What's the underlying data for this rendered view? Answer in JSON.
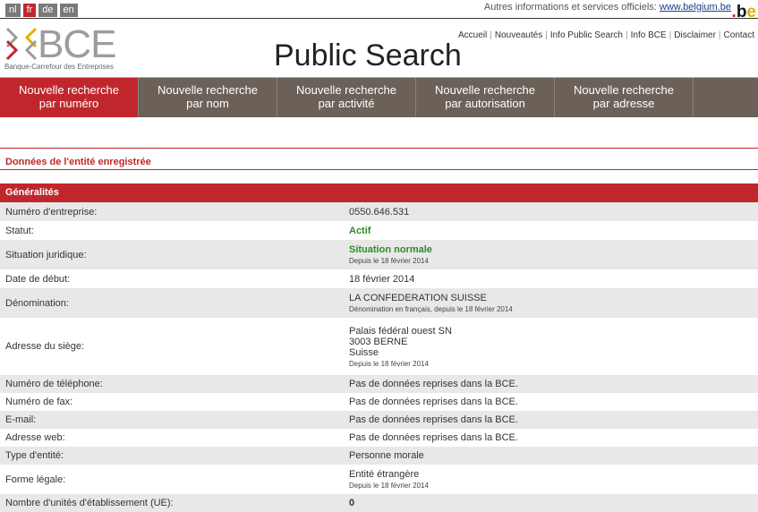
{
  "languages": [
    {
      "code": "nl",
      "active": false
    },
    {
      "code": "fr",
      "active": true
    },
    {
      "code": "de",
      "active": false
    },
    {
      "code": "en",
      "active": false
    }
  ],
  "belgium": {
    "text": "Autres informations et services officiels:",
    "link": "www.belgium.be"
  },
  "be_logo": {
    "b": "b",
    "e": "e",
    "dot": "."
  },
  "logo": {
    "name": "BCE",
    "subtitle": "Banque-Carrefour des Entreprises"
  },
  "page_title": "Public Search",
  "top_links": [
    "Accueil",
    "Nouveautés",
    "Info Public Search",
    "Info BCE",
    "Disclaimer",
    "Contact"
  ],
  "nav": [
    {
      "line1": "Nouvelle recherche",
      "line2": "par numéro",
      "active": true
    },
    {
      "line1": "Nouvelle recherche",
      "line2": "par nom",
      "active": false
    },
    {
      "line1": "Nouvelle recherche",
      "line2": "par activité",
      "active": false
    },
    {
      "line1": "Nouvelle recherche",
      "line2": "par autorisation",
      "active": false
    },
    {
      "line1": "Nouvelle recherche",
      "line2": "par adresse",
      "active": false
    }
  ],
  "section_title": "Données de l'entité enregistrée",
  "table_header": "Généralités",
  "rows": {
    "numero": {
      "label": "Numéro d'entreprise:",
      "value": "0550.646.531"
    },
    "statut": {
      "label": "Statut:",
      "value": "Actif"
    },
    "situation": {
      "label": "Situation juridique:",
      "value": "Situation normale",
      "note": "Depuis le 18 février 2014"
    },
    "date_debut": {
      "label": "Date de début:",
      "value": "18 février 2014"
    },
    "denomination": {
      "label": "Dénomination:",
      "value": "LA CONFEDERATION SUISSE",
      "note": "Dénomination en français, depuis le 18 février 2014"
    },
    "adresse": {
      "label": "Adresse du siège:",
      "line1": "Palais fédéral ouest SN",
      "line2": "3003 BERNE",
      "line3": "Suisse",
      "note": "Depuis le 18 février 2014"
    },
    "telephone": {
      "label": "Numéro de téléphone:",
      "value": "Pas de données reprises dans la BCE."
    },
    "fax": {
      "label": "Numéro de fax:",
      "value": "Pas de données reprises dans la BCE."
    },
    "email": {
      "label": "E-mail:",
      "value": "Pas de données reprises dans la BCE."
    },
    "web": {
      "label": "Adresse web:",
      "value": "Pas de données reprises dans la BCE."
    },
    "type": {
      "label": "Type d'entité:",
      "value": "Personne morale"
    },
    "forme": {
      "label": "Forme légale:",
      "value": "Entité étrangère",
      "note": "Depuis le 18 février 2014"
    },
    "unites": {
      "label": "Nombre d'unités d'établissement (UE):",
      "value": "0"
    }
  },
  "colors": {
    "brand_red": "#c0272d",
    "nav_bg": "#6b6158",
    "status_green": "#2f8a28"
  }
}
